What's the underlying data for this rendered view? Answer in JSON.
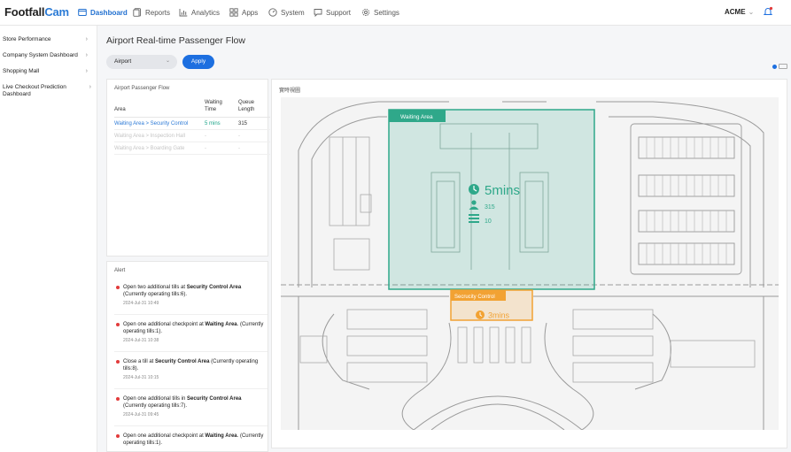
{
  "brand": {
    "name_a": "Footfall",
    "name_b": "Cam"
  },
  "nav": {
    "dashboard": "Dashboard",
    "reports": "Reports",
    "analytics": "Analytics",
    "apps": "Apps",
    "system": "System",
    "support": "Support",
    "settings": "Settings"
  },
  "account": {
    "name": "ACME",
    "caret": "⌄"
  },
  "sidebar": {
    "items": [
      {
        "label": "Store Performance",
        "chevron": "›"
      },
      {
        "label": "Company System Dashboard",
        "chevron": "›"
      },
      {
        "label": "Shopping Mall",
        "chevron": "›"
      },
      {
        "label": "Live Checkout Prediction Dashboard",
        "chevron": "›"
      }
    ]
  },
  "page": {
    "title": "Airport Real-time Passenger Flow",
    "filter_value": "Airport",
    "filter_caret": "⌄",
    "apply_label": "Apply"
  },
  "flow": {
    "title": "Airport Passenger Flow",
    "headers": {
      "area": "Area",
      "waiting": "Waiting Time",
      "queue": "Queue Length"
    },
    "rows": [
      {
        "area": "Waiting Area > Security Control",
        "waiting": "5 mins",
        "queue": "315"
      },
      {
        "area": "Waiting Area > Inspection Hall",
        "waiting": "-",
        "queue": "-"
      },
      {
        "area": "Waiting Area > Boarding Gate",
        "waiting": "-",
        "queue": "-"
      }
    ]
  },
  "alert": {
    "title": "Alert",
    "items": [
      {
        "pre": "Open two additional tills at ",
        "bold": "Security Control Area",
        "post": " (Currently operating tills:6).",
        "time": "2024-Jul-31 10:49"
      },
      {
        "pre": "Open one additional checkpoint at ",
        "bold": "Waiting Area",
        "post": ". (Currently operating tills:1).",
        "time": "2024-Jul-31 10:38"
      },
      {
        "pre": "Close a till at ",
        "bold": "Security Control Area",
        "post": " (Currently operating tills:8).",
        "time": "2024-Jul-31 10:15"
      },
      {
        "pre": "Open one additional tills in ",
        "bold": "Security Control Area",
        "post": " (Currently operating tills:7).",
        "time": "2024-Jul-31 09:45"
      },
      {
        "pre": "Open one additional checkpoint at ",
        "bold": "Waiting Area",
        "post": ". (Currently operating tills:1).",
        "time": ""
      }
    ]
  },
  "map": {
    "title": "實時視圖",
    "waiting_zone": {
      "label": "Waiting Area",
      "time": "5mins",
      "people": "315",
      "queues": "10"
    },
    "security_zone": {
      "label": "Secrucity Control",
      "time": "3mins"
    },
    "colors": {
      "waiting": "#2fa88a",
      "security": "#f2a233",
      "accent": "#1d6fe0",
      "alert": "#e23b3b"
    }
  }
}
